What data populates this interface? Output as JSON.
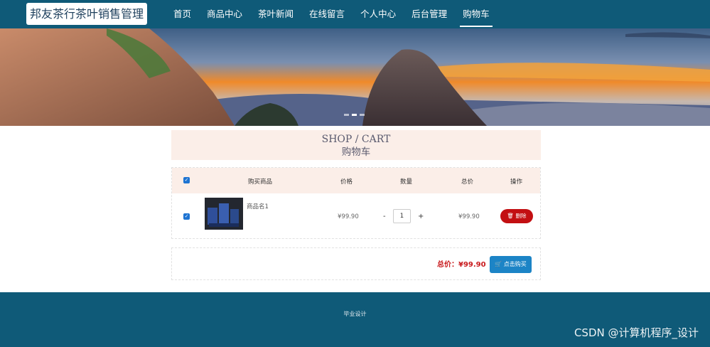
{
  "header": {
    "logo_text": "邦友茶行茶叶销售管理",
    "nav": [
      {
        "label": "首页"
      },
      {
        "label": "商品中心"
      },
      {
        "label": "茶叶新闻"
      },
      {
        "label": "在线留言"
      },
      {
        "label": "个人中心"
      },
      {
        "label": "后台管理"
      },
      {
        "label": "购物车"
      }
    ],
    "active_nav": "购物车"
  },
  "banner": {
    "slide_count": 3,
    "active_slide": 2
  },
  "cart_title": {
    "en": "SHOP / CART",
    "cn": "购物车"
  },
  "cart_table": {
    "columns": [
      "购买商品",
      "价格",
      "数量",
      "总价",
      "操作"
    ],
    "select_all_checked": true,
    "rows": [
      {
        "checked": true,
        "name": "商品名1",
        "price": "¥99.90",
        "minus": "-",
        "quantity": "1",
        "plus": "+",
        "subtotal": "¥99.90",
        "delete_label": "删除"
      }
    ]
  },
  "summary": {
    "total_label": "总价：¥99.90",
    "buy_label": "点击购买"
  },
  "footer": {
    "text": "毕业设计"
  },
  "watermark": "CSDN @计算机程序_设计",
  "colors": {
    "nav_bg": "#0f5a78",
    "head_bg": "#fbeee8",
    "delete": "#c30f12",
    "buy": "#1c84c6",
    "total": "#c8191c"
  }
}
